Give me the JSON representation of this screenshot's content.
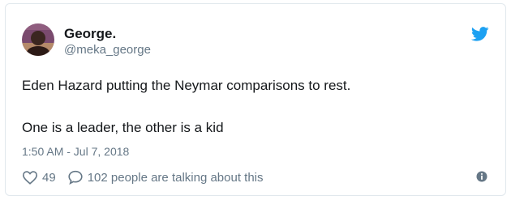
{
  "author": {
    "display_name": "George.",
    "handle": "@meka_george",
    "avatar_icon": "avatar-photo"
  },
  "tweet": {
    "line1": "Eden Hazard putting the Neymar comparisons to rest.",
    "line2": "One is a leader, the other is a kid",
    "timestamp": "1:50 AM - Jul 7, 2018"
  },
  "actions": {
    "like_count": "49",
    "reply_text": "102 people are talking about this",
    "like_icon": "heart-icon",
    "reply_icon": "speech-bubble-icon",
    "info_icon": "info-icon"
  },
  "brand": {
    "icon": "twitter-bird-icon",
    "color": "#1da1f2"
  },
  "colors": {
    "text": "#14171a",
    "secondary": "#657786",
    "border": "#e1e8ed"
  }
}
